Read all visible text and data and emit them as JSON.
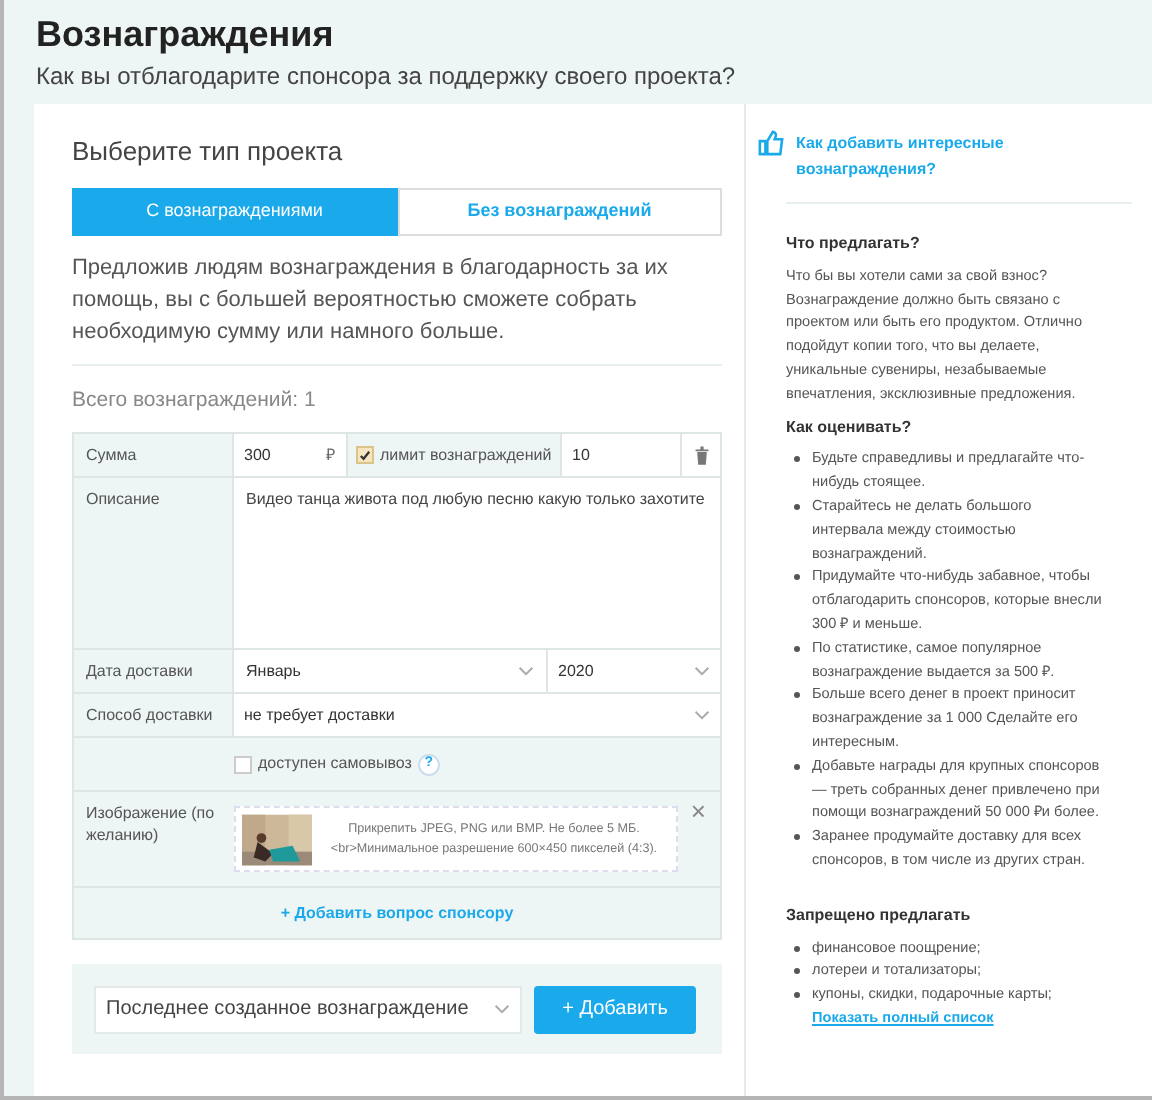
{
  "header": {
    "title": "Вознаграждения",
    "subtitle": "Как вы отблагодарите спонсора за поддержку своего проекта?"
  },
  "project_type": {
    "label": "Выберите тип проекта",
    "tabs": [
      {
        "label": "С вознаграждениями",
        "selected": true
      },
      {
        "label": "Без вознаграждений",
        "selected": false
      }
    ]
  },
  "intro": "Предложив людям вознаграждения в благодарность за их помощь, вы с большей вероятностью сможете собрать необходимую сумму или намного больше.",
  "total": "Всего вознаграждений: 1",
  "reward": {
    "amount_label": "Сумма",
    "amount": "300",
    "currency": "₽",
    "limit": {
      "label": "лимит вознаграждений",
      "checked": true
    },
    "limit_value": "10",
    "description_label": "Описание",
    "description": "Видео танца живота под любую песню какую только захотите",
    "date_label": "Дата доставки",
    "month": "Январь",
    "year": "2020",
    "delivery_label": "Способ доставки",
    "delivery": "не требует доставки",
    "pickup": {
      "label": "доступен самовывоз",
      "checked": false,
      "help": "?"
    },
    "image_label": "Изображение (по желанию)",
    "image_hint": "Прикрепить JPEG, PNG или BMP. Не более 5 МБ. <br>Минимальное разрешение 600×450 пикселей (4:3).",
    "image_close": "×",
    "add_question": "+ Добавить вопрос спонсору"
  },
  "footer": {
    "template": "Последнее созданное вознаграждение",
    "add_button": "+ Добавить"
  },
  "sidebar": {
    "link": "Как добавить интересные вознаграждения?",
    "sections": [
      {
        "title": "Что предлагать?",
        "text": "Что бы вы хотели сами за свой взнос? Вознаграждение должно быть связано с проектом или быть его продуктом. Отлично подойдут копии того, что вы делаете, уникальные сувениры, незабываемые впечатления, эксклюзивные предложения."
      },
      {
        "title": "Как оценивать?",
        "items": [
          "Будьте справедливы и предлагайте что-нибудь стоящее.",
          "Старайтесь не делать большого интервала между стоимостью вознаграждений.",
          "Придумайте что-нибудь забавное, чтобы отблагодарить спонсоров, которые внесли 300 ₽ и меньше.",
          "По статистике, самое популярное вознаграждение выдается за 500 ₽.",
          "Больше всего денег в проект приносит вознаграждение за 1 000  Сделайте его интересным.",
          "Добавьте награды для крупных спонсоров — треть собранных денег привлечено при помощи вознаграждений 50 000 ₽и более.",
          "Заранее продумайте доставку для всех спонсоров, в том числе из других стран."
        ]
      },
      {
        "title": "Запрещено предлагать",
        "items": [
          "финансовое поощрение;",
          "лотереи и тотализаторы;",
          "купоны, скидки, подарочные карты;"
        ]
      }
    ],
    "show_all": "Показать полный список"
  }
}
